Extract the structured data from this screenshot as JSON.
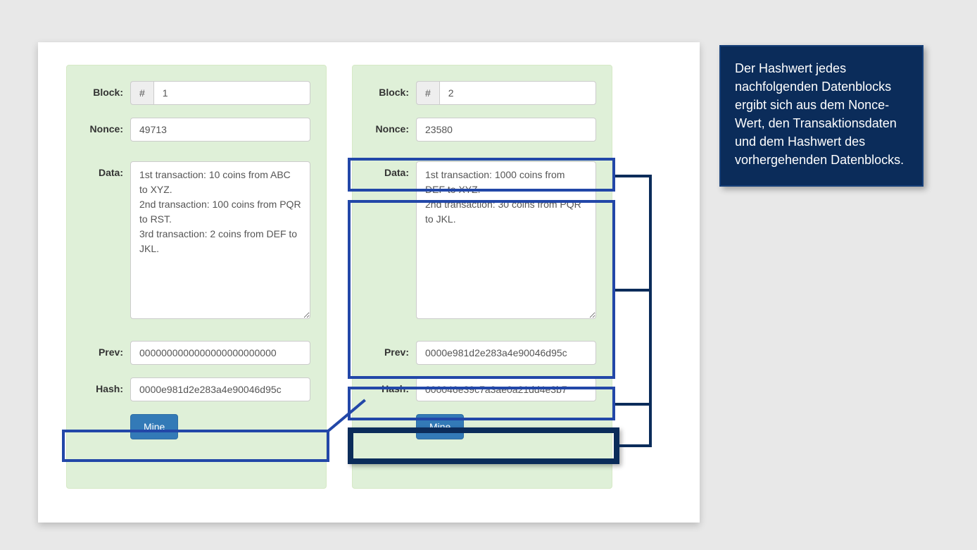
{
  "labels": {
    "block": "Block:",
    "nonce": "Nonce:",
    "data": "Data:",
    "prev": "Prev:",
    "hash": "Hash:",
    "mine": "Mine",
    "hashAddon": "#"
  },
  "blocks": [
    {
      "number": "1",
      "nonce": "49713",
      "data": "1st transaction: 10 coins from ABC to XYZ.\n2nd transaction: 100 coins from PQR to RST.\n3rd transaction: 2 coins from DEF to JKL.",
      "prev": "0000000000000000000000000",
      "hash": "0000e981d2e283a4e90046d95c"
    },
    {
      "number": "2",
      "nonce": "23580",
      "data": "1st transaction: 1000 coins from DEF to XYZ.\n2nd transaction: 30 coins from PQR to JKL.",
      "prev": "0000e981d2e283a4e90046d95c",
      "hash": "000046e39c7a3ae0a21dd4e3b7"
    }
  ],
  "callout": "Der Hashwert jedes nachfolgenden Datenblocks ergibt sich aus dem Nonce-Wert, den Transaktionsdaten und dem Hashwert des vorhergehenden Datenblocks."
}
